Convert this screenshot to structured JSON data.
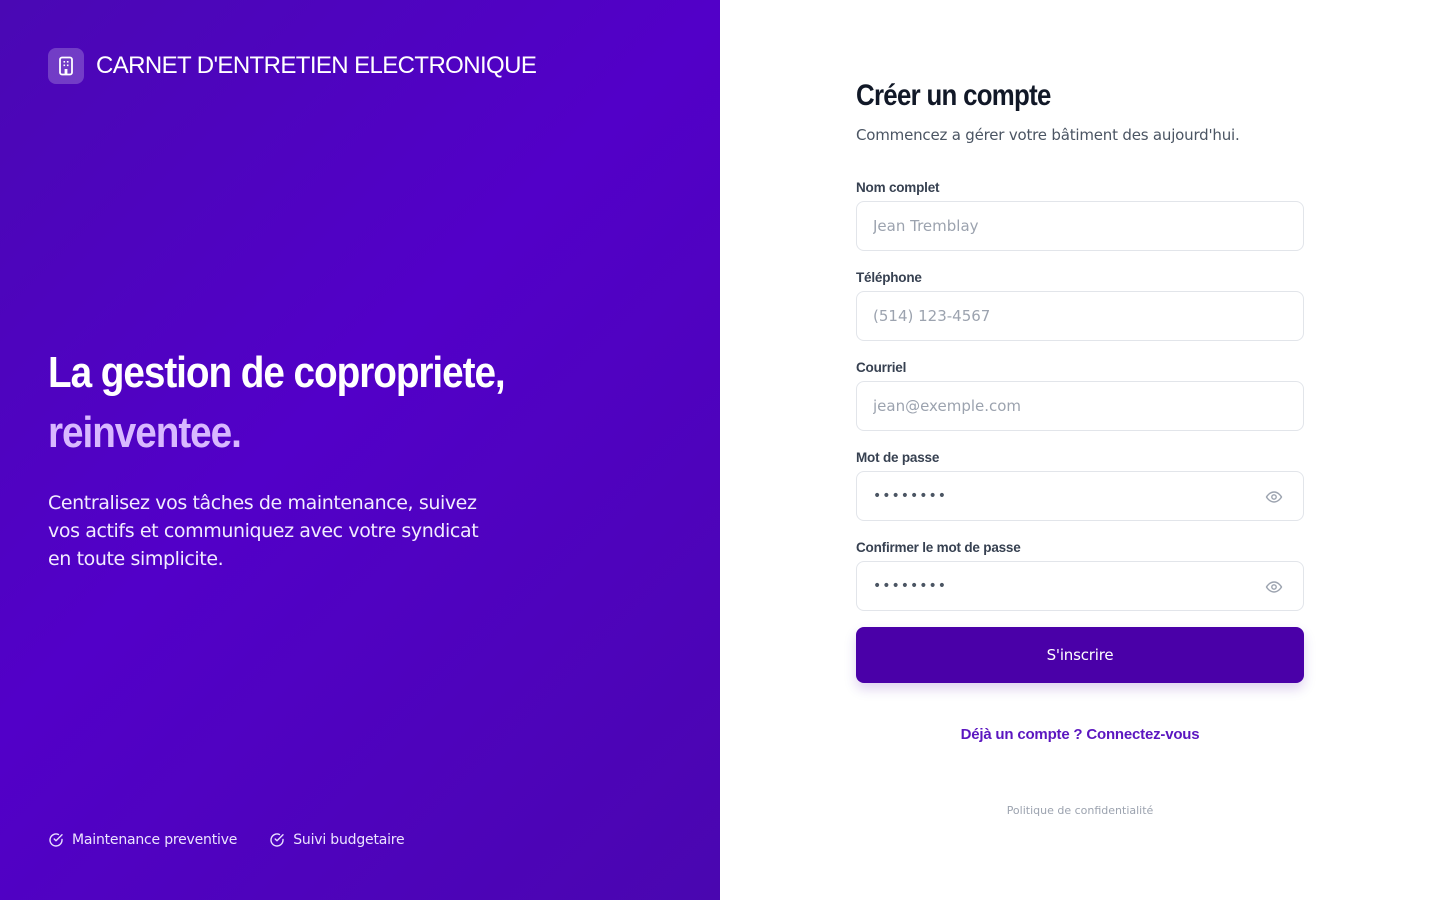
{
  "brand": {
    "title": "CARNET D'ENTRETIEN ELECTRONIQUE",
    "icon": "building-icon"
  },
  "hero": {
    "title_line1": "La gestion de copropriete,",
    "title_line2": "reinventee.",
    "description": "Centralisez vos tâches de maintenance, suivez vos actifs et communiquez avec votre syndicat en toute simplicite."
  },
  "features": [
    {
      "label": "Maintenance preventive",
      "icon": "check-circle-icon"
    },
    {
      "label": "Suivi budgetaire",
      "icon": "check-circle-icon"
    }
  ],
  "form": {
    "title": "Créer un compte",
    "subtitle": "Commencez a gérer votre bâtiment des aujourd'hui.",
    "fields": {
      "name": {
        "label": "Nom complet",
        "placeholder": "Jean Tremblay"
      },
      "phone": {
        "label": "Téléphone",
        "placeholder": "(514) 123-4567"
      },
      "email": {
        "label": "Courriel",
        "placeholder": "jean@exemple.com"
      },
      "password": {
        "label": "Mot de passe",
        "value": "••••••••",
        "icon": "eye-icon"
      },
      "confirm_password": {
        "label": "Confirmer le mot de passe",
        "value": "••••••••",
        "icon": "eye-icon"
      }
    },
    "submit_label": "S'inscrire",
    "login_link": "Déjà un compte ? Connectez-vous",
    "privacy_link": "Politique de confidentialité"
  },
  "colors": {
    "left_panel": "#5200c8",
    "accent_text": "#d8b8ff",
    "button": "#4a00a8",
    "link": "#5b16c0"
  }
}
